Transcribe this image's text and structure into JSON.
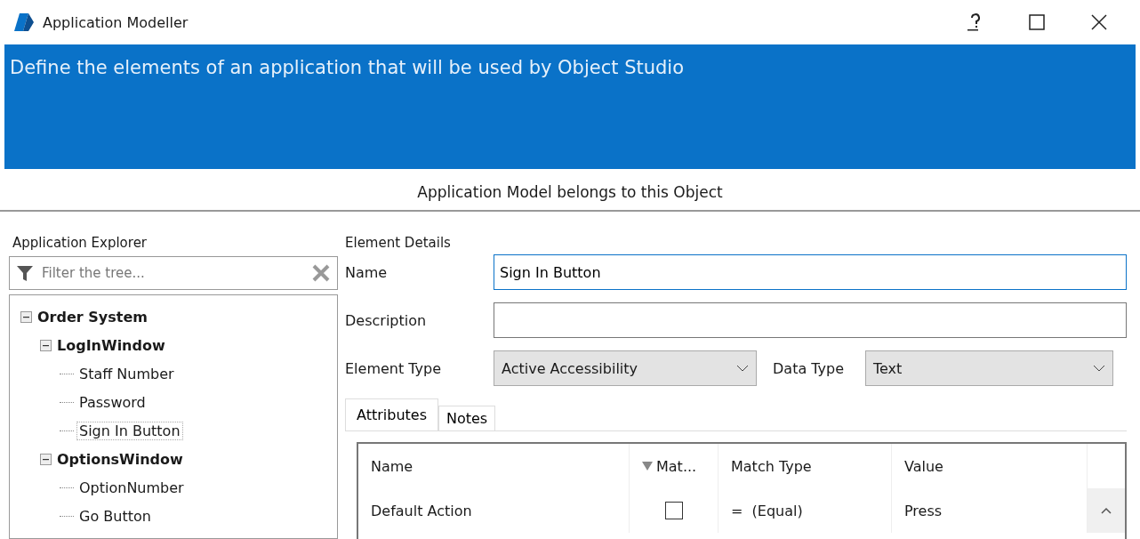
{
  "window": {
    "title": "Application Modeller"
  },
  "banner": {
    "text": "Define the elements of an application that will be used by Object Studio"
  },
  "subtitle": "Application Model belongs to this Object",
  "explorer": {
    "title": "Application Explorer",
    "filter": {
      "placeholder": "Filter the tree..."
    },
    "tree": [
      {
        "label": "Order System",
        "expanded": true,
        "selected": false,
        "children": [
          {
            "label": "LogInWindow",
            "expanded": true,
            "selected": false,
            "children": [
              {
                "label": "Staff Number",
                "selected": false
              },
              {
                "label": "Password",
                "selected": false
              },
              {
                "label": "Sign In Button",
                "selected": true
              }
            ]
          },
          {
            "label": "OptionsWindow",
            "expanded": true,
            "selected": false,
            "children": [
              {
                "label": "OptionNumber",
                "selected": false
              },
              {
                "label": "Go Button",
                "selected": false
              }
            ]
          }
        ]
      }
    ]
  },
  "details": {
    "title": "Element Details",
    "name": {
      "label": "Name",
      "value": "Sign In Button"
    },
    "description": {
      "label": "Description"
    },
    "element_type": {
      "label": "Element Type",
      "value": "Active Accessibility"
    },
    "data_type": {
      "label": "Data Type",
      "value": "Text"
    },
    "tabs": [
      {
        "label": "Attributes",
        "selected": true
      },
      {
        "label": "Notes",
        "selected": false
      }
    ],
    "table": {
      "columns": [
        "Name",
        "Mat...",
        "Match Type",
        "Value"
      ],
      "rows": [
        {
          "name": "Default Action",
          "checked": false,
          "match_type": "=  (Equal)",
          "value": "Press"
        }
      ]
    }
  }
}
